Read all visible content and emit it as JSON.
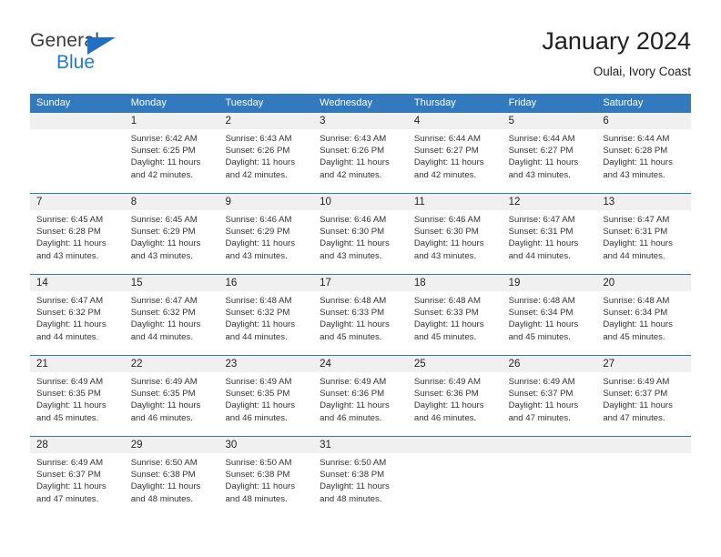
{
  "brand": {
    "name_part1": "General",
    "name_part2": "Blue",
    "triangle_color": "#1f6fc4",
    "blue_color": "#1f7ad4"
  },
  "header": {
    "title": "January 2024",
    "subtitle": "Oulai, Ivory Coast"
  },
  "colors": {
    "header_row_bg": "#3279bd",
    "header_row_text": "#ffffff",
    "date_band_bg": "#f0f0f0",
    "row_separator": "#3279bd",
    "body_text": "#333333"
  },
  "calendar": {
    "weekday_headers": [
      "Sunday",
      "Monday",
      "Tuesday",
      "Wednesday",
      "Thursday",
      "Friday",
      "Saturday"
    ],
    "weeks": [
      [
        {
          "day": "",
          "lines": []
        },
        {
          "day": "1",
          "lines": [
            "Sunrise: 6:42 AM",
            "Sunset: 6:25 PM",
            "Daylight: 11 hours",
            "and 42 minutes."
          ]
        },
        {
          "day": "2",
          "lines": [
            "Sunrise: 6:43 AM",
            "Sunset: 6:26 PM",
            "Daylight: 11 hours",
            "and 42 minutes."
          ]
        },
        {
          "day": "3",
          "lines": [
            "Sunrise: 6:43 AM",
            "Sunset: 6:26 PM",
            "Daylight: 11 hours",
            "and 42 minutes."
          ]
        },
        {
          "day": "4",
          "lines": [
            "Sunrise: 6:44 AM",
            "Sunset: 6:27 PM",
            "Daylight: 11 hours",
            "and 42 minutes."
          ]
        },
        {
          "day": "5",
          "lines": [
            "Sunrise: 6:44 AM",
            "Sunset: 6:27 PM",
            "Daylight: 11 hours",
            "and 43 minutes."
          ]
        },
        {
          "day": "6",
          "lines": [
            "Sunrise: 6:44 AM",
            "Sunset: 6:28 PM",
            "Daylight: 11 hours",
            "and 43 minutes."
          ]
        }
      ],
      [
        {
          "day": "7",
          "lines": [
            "Sunrise: 6:45 AM",
            "Sunset: 6:28 PM",
            "Daylight: 11 hours",
            "and 43 minutes."
          ]
        },
        {
          "day": "8",
          "lines": [
            "Sunrise: 6:45 AM",
            "Sunset: 6:29 PM",
            "Daylight: 11 hours",
            "and 43 minutes."
          ]
        },
        {
          "day": "9",
          "lines": [
            "Sunrise: 6:46 AM",
            "Sunset: 6:29 PM",
            "Daylight: 11 hours",
            "and 43 minutes."
          ]
        },
        {
          "day": "10",
          "lines": [
            "Sunrise: 6:46 AM",
            "Sunset: 6:30 PM",
            "Daylight: 11 hours",
            "and 43 minutes."
          ]
        },
        {
          "day": "11",
          "lines": [
            "Sunrise: 6:46 AM",
            "Sunset: 6:30 PM",
            "Daylight: 11 hours",
            "and 43 minutes."
          ]
        },
        {
          "day": "12",
          "lines": [
            "Sunrise: 6:47 AM",
            "Sunset: 6:31 PM",
            "Daylight: 11 hours",
            "and 44 minutes."
          ]
        },
        {
          "day": "13",
          "lines": [
            "Sunrise: 6:47 AM",
            "Sunset: 6:31 PM",
            "Daylight: 11 hours",
            "and 44 minutes."
          ]
        }
      ],
      [
        {
          "day": "14",
          "lines": [
            "Sunrise: 6:47 AM",
            "Sunset: 6:32 PM",
            "Daylight: 11 hours",
            "and 44 minutes."
          ]
        },
        {
          "day": "15",
          "lines": [
            "Sunrise: 6:47 AM",
            "Sunset: 6:32 PM",
            "Daylight: 11 hours",
            "and 44 minutes."
          ]
        },
        {
          "day": "16",
          "lines": [
            "Sunrise: 6:48 AM",
            "Sunset: 6:32 PM",
            "Daylight: 11 hours",
            "and 44 minutes."
          ]
        },
        {
          "day": "17",
          "lines": [
            "Sunrise: 6:48 AM",
            "Sunset: 6:33 PM",
            "Daylight: 11 hours",
            "and 45 minutes."
          ]
        },
        {
          "day": "18",
          "lines": [
            "Sunrise: 6:48 AM",
            "Sunset: 6:33 PM",
            "Daylight: 11 hours",
            "and 45 minutes."
          ]
        },
        {
          "day": "19",
          "lines": [
            "Sunrise: 6:48 AM",
            "Sunset: 6:34 PM",
            "Daylight: 11 hours",
            "and 45 minutes."
          ]
        },
        {
          "day": "20",
          "lines": [
            "Sunrise: 6:48 AM",
            "Sunset: 6:34 PM",
            "Daylight: 11 hours",
            "and 45 minutes."
          ]
        }
      ],
      [
        {
          "day": "21",
          "lines": [
            "Sunrise: 6:49 AM",
            "Sunset: 6:35 PM",
            "Daylight: 11 hours",
            "and 45 minutes."
          ]
        },
        {
          "day": "22",
          "lines": [
            "Sunrise: 6:49 AM",
            "Sunset: 6:35 PM",
            "Daylight: 11 hours",
            "and 46 minutes."
          ]
        },
        {
          "day": "23",
          "lines": [
            "Sunrise: 6:49 AM",
            "Sunset: 6:35 PM",
            "Daylight: 11 hours",
            "and 46 minutes."
          ]
        },
        {
          "day": "24",
          "lines": [
            "Sunrise: 6:49 AM",
            "Sunset: 6:36 PM",
            "Daylight: 11 hours",
            "and 46 minutes."
          ]
        },
        {
          "day": "25",
          "lines": [
            "Sunrise: 6:49 AM",
            "Sunset: 6:36 PM",
            "Daylight: 11 hours",
            "and 46 minutes."
          ]
        },
        {
          "day": "26",
          "lines": [
            "Sunrise: 6:49 AM",
            "Sunset: 6:37 PM",
            "Daylight: 11 hours",
            "and 47 minutes."
          ]
        },
        {
          "day": "27",
          "lines": [
            "Sunrise: 6:49 AM",
            "Sunset: 6:37 PM",
            "Daylight: 11 hours",
            "and 47 minutes."
          ]
        }
      ],
      [
        {
          "day": "28",
          "lines": [
            "Sunrise: 6:49 AM",
            "Sunset: 6:37 PM",
            "Daylight: 11 hours",
            "and 47 minutes."
          ]
        },
        {
          "day": "29",
          "lines": [
            "Sunrise: 6:50 AM",
            "Sunset: 6:38 PM",
            "Daylight: 11 hours",
            "and 48 minutes."
          ]
        },
        {
          "day": "30",
          "lines": [
            "Sunrise: 6:50 AM",
            "Sunset: 6:38 PM",
            "Daylight: 11 hours",
            "and 48 minutes."
          ]
        },
        {
          "day": "31",
          "lines": [
            "Sunrise: 6:50 AM",
            "Sunset: 6:38 PM",
            "Daylight: 11 hours",
            "and 48 minutes."
          ]
        },
        {
          "day": "",
          "lines": []
        },
        {
          "day": "",
          "lines": []
        },
        {
          "day": "",
          "lines": []
        }
      ]
    ]
  }
}
